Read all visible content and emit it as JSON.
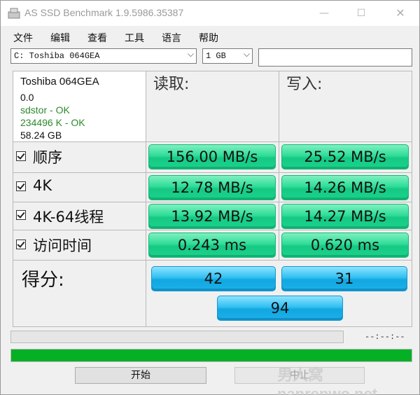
{
  "window": {
    "title": "AS SSD Benchmark 1.9.5986.35387",
    "minimize": "—",
    "maximize": "☐",
    "close": "✕"
  },
  "menu": [
    "文件",
    "编辑",
    "查看",
    "工具",
    "语言",
    "帮助"
  ],
  "drive_select": {
    "value": "C: Toshiba 064GEA"
  },
  "size_select": {
    "value": "1 GB"
  },
  "text_field": {
    "value": ""
  },
  "drive_info": {
    "name": "Toshiba 064GEA",
    "version": "0.0",
    "driver": "sdstor - OK",
    "alignment": "234496 K - OK",
    "capacity": "58.24 GB"
  },
  "columns": {
    "read": "读取:",
    "write": "写入:"
  },
  "tests": [
    {
      "label": "顺序",
      "checked": true,
      "read": "156.00 MB/s",
      "write": "25.52 MB/s"
    },
    {
      "label": "4K",
      "checked": true,
      "read": "12.78 MB/s",
      "write": "14.26 MB/s"
    },
    {
      "label": "4K-64线程",
      "checked": true,
      "read": "13.92 MB/s",
      "write": "14.27 MB/s"
    },
    {
      "label": "访问时间",
      "checked": true,
      "read": "0.243 ms",
      "write": "0.620 ms"
    }
  ],
  "score": {
    "label": "得分:",
    "read": "42",
    "write": "31",
    "total": "94"
  },
  "timer": "--:--:--",
  "overall_progress": 1.0,
  "buttons": {
    "start": "开始",
    "stop": "中止"
  },
  "watermark": "男人窝 nanrenwo.net",
  "colors": {
    "result_green": "#1ad28b",
    "score_blue": "#1bb1ea",
    "progress_green": "#06b025"
  }
}
